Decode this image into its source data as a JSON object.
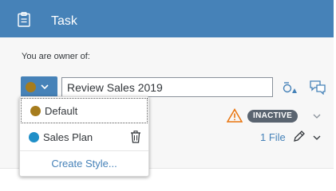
{
  "header": {
    "title": "Task",
    "icon": "clipboard-icon"
  },
  "owner": {
    "label": "You are owner of:"
  },
  "style_button": {
    "color": "#a67c1d",
    "icon": "chevron-down-icon"
  },
  "name_input": {
    "value": "Review Sales 2019"
  },
  "toolbar": {
    "sort_icon": "sort-shapes-icon",
    "comment_icon": "comments-icon"
  },
  "status": {
    "warning_icon": "warning-icon",
    "badge": "INACTIVE"
  },
  "attachments": {
    "label": "1 File"
  },
  "dropdown": {
    "items": [
      {
        "label": "Default",
        "color": "#a67c1d"
      },
      {
        "label": "Sales Plan",
        "color": "#1f8fc8",
        "action_icon": "trash-icon"
      }
    ],
    "create_label": "Create Style..."
  },
  "colors": {
    "brand": "#4682b8",
    "badge_bg": "#5a6470",
    "warning": "#e9730c"
  }
}
